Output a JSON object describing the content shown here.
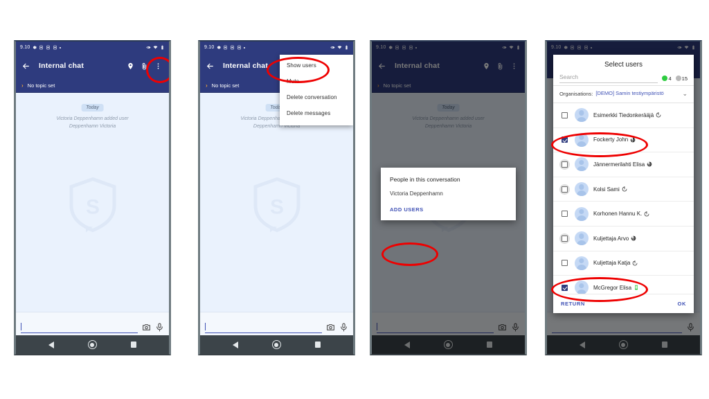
{
  "app": {
    "status_bar": {
      "time": "9.10",
      "left_icons": [
        "gear-icon",
        "notification-icon",
        "notification-icon",
        "notification-icon",
        "dot-icon"
      ],
      "right_icons": [
        "eye-icon",
        "wifi-icon",
        "battery-icon"
      ]
    },
    "appbar": {
      "title": "Internal chat",
      "back_icon": "back-arrow-icon",
      "location_icon": "location-pin-icon",
      "attach_icon": "paperclip-icon",
      "overflow_icon": "more-vert-icon"
    },
    "topic_bar": {
      "label": "No topic set",
      "chevron": "chevron-right-icon"
    },
    "chat": {
      "date_chip": "Today",
      "system_message": "Victoria Deppenhamn added user\nDeppenhamn Victoria",
      "watermark_letter": "S"
    },
    "composer": {
      "camera_icon": "camera-icon",
      "mic_icon": "microphone-icon"
    },
    "navbar": {
      "back": "nav-back-icon",
      "home": "nav-home-icon",
      "recents": "nav-recents-icon"
    }
  },
  "overflow_menu": {
    "items": [
      {
        "label": "Show users"
      },
      {
        "label": "Mute"
      },
      {
        "label": "Delete conversation"
      },
      {
        "label": "Delete messages"
      }
    ]
  },
  "people_dialog": {
    "title": "People in this conversation",
    "people": [
      "Victoria Deppenhamn"
    ],
    "action": "ADD USERS"
  },
  "select_users": {
    "title": "Select users",
    "search_placeholder": "Search",
    "counts": {
      "online": {
        "value": "4",
        "color": "#2ecc40"
      },
      "offline": {
        "value": "15",
        "color": "#b9b9b9"
      }
    },
    "organisations": {
      "label": "Organisations:",
      "value": "[DEMO] Samin testiympäristö",
      "chevron": "chevron-down-icon"
    },
    "users": [
      {
        "name": "Esimerkki Tiedonkerääjä",
        "checked": false,
        "ripple": false,
        "status": "clock-icon"
      },
      {
        "name": "Fockerty John",
        "checked": true,
        "ripple": false,
        "status": "globe-icon"
      },
      {
        "name": "Jännermerilahti Elisa",
        "checked": false,
        "ripple": true,
        "status": "globe-icon"
      },
      {
        "name": "Kolsi Sami",
        "checked": false,
        "ripple": true,
        "status": "clock-icon"
      },
      {
        "name": "Korhonen Hannu K.",
        "checked": false,
        "ripple": false,
        "status": "clock-icon"
      },
      {
        "name": "Kuljettaja Arvo",
        "checked": false,
        "ripple": true,
        "status": "globe-icon"
      },
      {
        "name": "Kuljettaja Katja",
        "checked": false,
        "ripple": false,
        "status": "clock-icon"
      },
      {
        "name": "McGregor Elisa",
        "checked": true,
        "ripple": false,
        "status": "mobile-green-icon"
      }
    ],
    "footer": {
      "return_label": "RETURN",
      "ok_label": "OK"
    }
  },
  "annotations": {
    "overflow_highlight": "more-vert-icon",
    "show_users_highlight": "Show users",
    "add_users_highlight": "ADD USERS",
    "fockerty_highlight": "Fockerty John",
    "mcgregor_highlight": "McGregor Elisa",
    "color": "#ee0000"
  }
}
